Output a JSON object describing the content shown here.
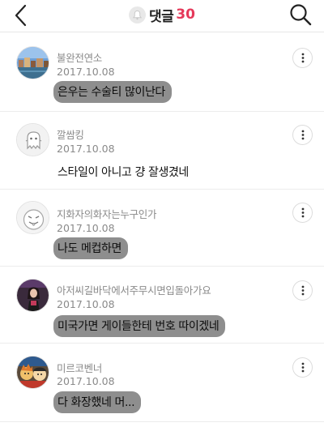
{
  "header": {
    "title": "댓글",
    "count": "30",
    "back_icon": "back-chevron-icon",
    "bell_icon": "bell-icon",
    "search_icon": "search-icon"
  },
  "comments": [
    {
      "author": "불완전연소",
      "date": "2017.10.08",
      "text": "은우는 수술티 많이난다",
      "highlighted": true,
      "avatar_icon": "city-photo-avatar"
    },
    {
      "author": "깔쌈킹",
      "date": "2017.10.08",
      "text": "스타일이 아니고 걍 잘생겼네",
      "highlighted": false,
      "avatar_icon": "ghost-character-avatar"
    },
    {
      "author": "지화자의화자는누구인가",
      "date": "2017.10.08",
      "text": "나도 메컵하면",
      "highlighted": true,
      "avatar_icon": "tongue-face-avatar"
    },
    {
      "author": "아저씨길바닥에서주무시면입돌아가요",
      "date": "2017.10.08",
      "text": "미국가면 게이들한테 번호 따이겠네",
      "highlighted": true,
      "avatar_icon": "performer-photo-avatar"
    },
    {
      "author": "미르코벤너",
      "date": "2017.10.08",
      "text": "다 화장했네 머...",
      "highlighted": true,
      "avatar_icon": "cartoon-characters-avatar"
    }
  ],
  "more_icon": "more-vertical-icon",
  "colors": {
    "accent": "#e5395a",
    "highlight": "#8e8e8e",
    "meta_text": "#8a8a8a"
  }
}
